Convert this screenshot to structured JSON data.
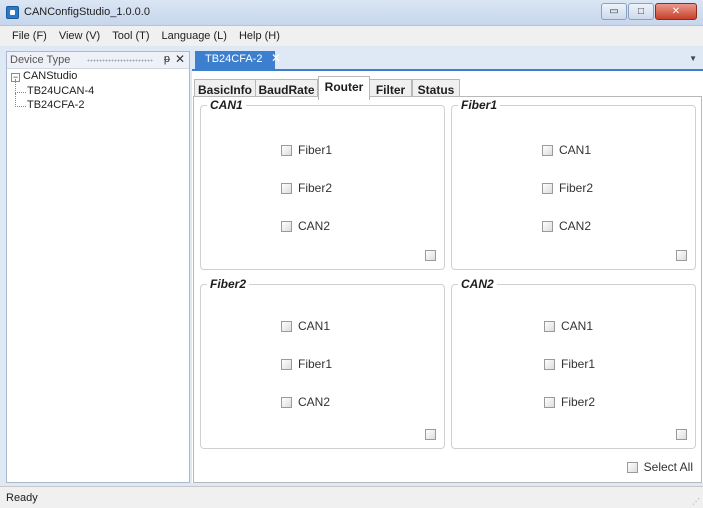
{
  "window": {
    "title": "CANConfigStudio_1.0.0.0",
    "minimize_glyph": "▭",
    "maximize_glyph": "□",
    "close_glyph": "✕"
  },
  "menu": {
    "items": [
      "File (F)",
      "View (V)",
      "Tool (T)",
      "Language (L)",
      "Help (H)"
    ]
  },
  "device_panel": {
    "title": "Device Type",
    "pin_glyph": "ᵽ",
    "close_glyph": "✕",
    "tree": {
      "root": "CANStudio",
      "expander_glyph": "−",
      "children": [
        "TB24UCAN-4",
        "TB24CFA-2"
      ]
    }
  },
  "document_tab": {
    "label": "TB24CFA-2",
    "close_glyph": "✕",
    "dropdown_glyph": "▼"
  },
  "sub_tabs": {
    "items": [
      "BasicInfo",
      "BaudRate",
      "Router",
      "Filter",
      "Status"
    ],
    "active": "Router"
  },
  "groups": [
    {
      "title": "CAN1",
      "options": [
        "Fiber1",
        "Fiber2",
        "CAN2"
      ]
    },
    {
      "title": "Fiber1",
      "options": [
        "CAN1",
        "Fiber2",
        "CAN2"
      ]
    },
    {
      "title": "Fiber2",
      "options": [
        "CAN1",
        "Fiber1",
        "CAN2"
      ]
    },
    {
      "title": "CAN2",
      "options": [
        "CAN1",
        "Fiber1",
        "Fiber2"
      ]
    }
  ],
  "select_all_label": "Select All",
  "status": {
    "text": "Ready",
    "grip_glyph": "⋰"
  },
  "colors": {
    "accent": "#3d7fcf",
    "close_button": "#c8402b"
  }
}
